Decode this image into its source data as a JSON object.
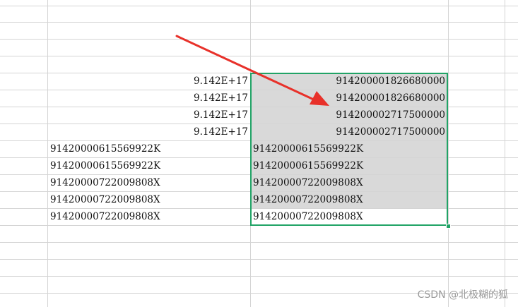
{
  "column_a_rows": [
    {
      "text": "9.142E+17"
    },
    {
      "text": "9.142E+17"
    },
    {
      "text": "9.142E+17"
    },
    {
      "text": "9.142E+17"
    },
    {
      "text": "91420000615569922K"
    },
    {
      "text": "91420000615569922K"
    },
    {
      "text": "91420000722009808X"
    },
    {
      "text": "91420000722009808X"
    },
    {
      "text": "91420000722009808X"
    }
  ],
  "column_b_rows": [
    {
      "text": "914200001826680000"
    },
    {
      "text": "914200001826680000"
    },
    {
      "text": "914200002717500000"
    },
    {
      "text": "914200002717500000"
    },
    {
      "text": "91420000615569922K"
    },
    {
      "text": "91420000615569922K"
    },
    {
      "text": "91420000722009808X"
    },
    {
      "text": "91420000722009808X"
    },
    {
      "text": "91420000722009808X"
    }
  ],
  "watermark": "CSDN @北极糊的狐",
  "colors": {
    "selection_border": "#21a366",
    "selected_fill": "#d9d9d9",
    "arrow": "#e8312a",
    "gridline": "#d4d4d4"
  },
  "icons": [
    "red-arrow-annotation"
  ]
}
